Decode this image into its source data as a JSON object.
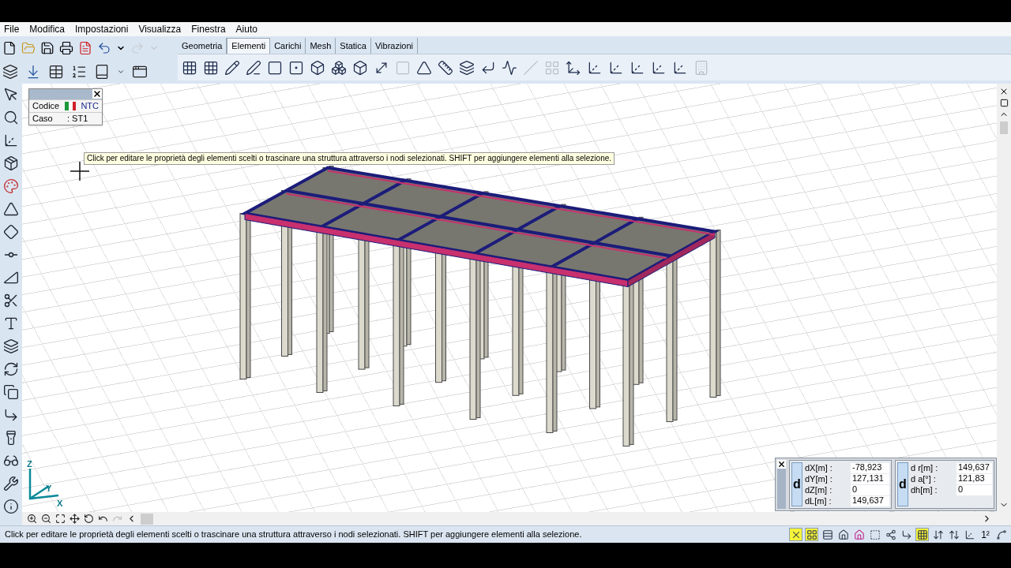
{
  "menu": [
    "File",
    "Modifica",
    "Impostazioni",
    "Visualizza",
    "Finestra",
    "Aiuto"
  ],
  "main_toolbar": [
    {
      "disabled": false
    },
    {
      "disabled": false
    },
    {
      "disabled": false
    },
    {
      "disabled": false
    },
    {
      "disabled": false
    },
    {
      "disabled": false
    },
    {
      "disabled": false
    },
    {
      "disabled": true
    },
    {
      "disabled": true
    }
  ],
  "tabs": [
    {
      "label": "Geometria",
      "selected": false
    },
    {
      "label": "Elementi",
      "selected": true
    },
    {
      "label": "Carichi",
      "selected": false
    },
    {
      "label": "Mesh",
      "selected": false
    },
    {
      "label": "Statica",
      "selected": false
    },
    {
      "label": "Vibrazioni",
      "selected": false
    }
  ],
  "element_toolbar": [
    {
      "disabled": false
    },
    {
      "disabled": false
    },
    {
      "disabled": false
    },
    {
      "disabled": false
    },
    {
      "disabled": false
    },
    {
      "disabled": false
    },
    {
      "disabled": false
    },
    {
      "disabled": false
    },
    {
      "disabled": false
    },
    {
      "disabled": false
    },
    {
      "disabled": true
    },
    {
      "disabled": false
    },
    {
      "disabled": false
    },
    {
      "disabled": false
    },
    {
      "disabled": false
    },
    {
      "disabled": false
    },
    {
      "disabled": true
    },
    {
      "disabled": true
    },
    {
      "disabled": false
    },
    {
      "disabled": false
    },
    {
      "disabled": false
    },
    {
      "disabled": false
    },
    {
      "disabled": false
    },
    {
      "disabled": false
    },
    {
      "disabled": true
    }
  ],
  "info_box": {
    "rows": [
      {
        "label": "Codice",
        "value": "NTC"
      },
      {
        "label": "Caso",
        "value": ": ST1"
      }
    ]
  },
  "tooltip": "Click per editare le proprietà degli elementi scelti o trascinare una struttura attraverso i nodi selezionati. SHIFT per aggiungere elementi alla selezione.",
  "axes": {
    "z": "Z",
    "y": "Y",
    "x": "X"
  },
  "measure_panel": {
    "left": {
      "badge": "d",
      "rows": [
        {
          "label": "dX[m] :",
          "value": "-78,923"
        },
        {
          "label": "dY[m] :",
          "value": "127,131"
        },
        {
          "label": "dZ[m] :",
          "value": "0"
        },
        {
          "label": "dL[m] :",
          "value": "149,637"
        }
      ]
    },
    "right": {
      "badge": "d",
      "rows": [
        {
          "label": "d r[m] :",
          "value": "149,637"
        },
        {
          "label": "d a[°] :",
          "value": "121,83"
        },
        {
          "label": "dh[m] :",
          "value": "0"
        }
      ]
    }
  },
  "status_bar": "Click per editare le proprietà degli elementi scelti o trascinare una struttura attraverso i nodi selezionati. SHIFT per aggiungere elementi alla selezione.",
  "status_toggles": [
    {
      "kind": "icon",
      "on": true
    },
    {
      "kind": "icon",
      "on": true
    },
    {
      "kind": "icon",
      "on": false
    },
    {
      "kind": "icon",
      "on": false
    },
    {
      "kind": "icon",
      "on": false
    },
    {
      "kind": "icon",
      "on": false
    },
    {
      "kind": "icon",
      "on": false
    },
    {
      "kind": "icon",
      "on": false
    },
    {
      "kind": "icon",
      "on": true
    },
    {
      "kind": "icon",
      "on": false
    },
    {
      "kind": "icon",
      "on": false
    },
    {
      "kind": "icon",
      "on": false
    },
    {
      "kind": "text",
      "label": "1²",
      "on": false
    },
    {
      "kind": "icon",
      "on": false
    }
  ]
}
